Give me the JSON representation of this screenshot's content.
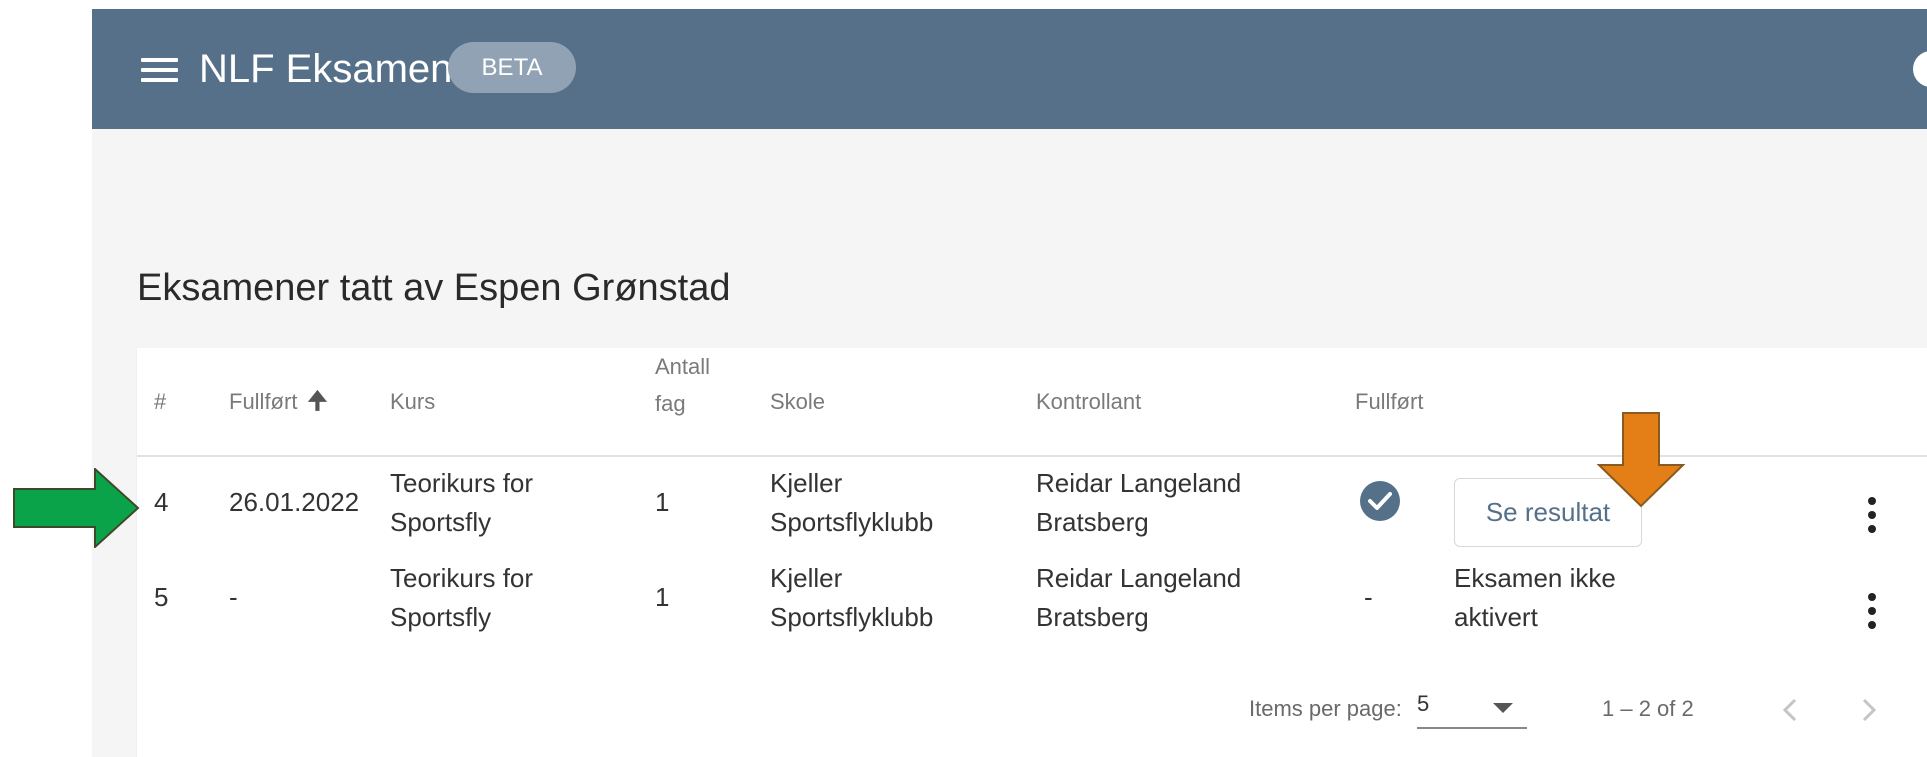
{
  "toolbar": {
    "title": "NLF Eksamen",
    "badge": "BETA",
    "background": "#567089"
  },
  "page": {
    "heading": "Eksamener tatt av Espen Grønstad"
  },
  "table": {
    "columns": {
      "index": "#",
      "completed_date": "Fullført",
      "course": "Kurs",
      "subjects_line1": "Antall",
      "subjects_line2": "fag",
      "school": "Skole",
      "controller": "Kontrollant",
      "completed": "Fullført"
    },
    "sort_icon": "arrow-up-icon",
    "rows": [
      {
        "index": "4",
        "date": "26.01.2022",
        "course_line1": "Teorikurs for",
        "course_line2": "Sportsfly",
        "subjects": "1",
        "school_line1": "Kjeller",
        "school_line2": "Sportsflyklubb",
        "controller_line1": "Reidar Langeland",
        "controller_line2": "Bratsberg",
        "completed_icon": "check-circle-icon",
        "action_label": "Se resultat"
      },
      {
        "index": "5",
        "date": "-",
        "course_line1": "Teorikurs for",
        "course_line2": "Sportsfly",
        "subjects": "1",
        "school_line1": "Kjeller",
        "school_line2": "Sportsflyklubb",
        "controller_line1": "Reidar Langeland",
        "controller_line2": "Bratsberg",
        "completed_text": "-",
        "status_line1": "Eksamen ikke",
        "status_line2": "aktivert"
      }
    ]
  },
  "paginator": {
    "items_per_page_label": "Items per page:",
    "page_size": "5",
    "range_label": "1 – 2 of 2"
  },
  "annotations": {
    "green_arrow_color": "#0aa34a",
    "orange_arrow_color": "#e37f16"
  }
}
